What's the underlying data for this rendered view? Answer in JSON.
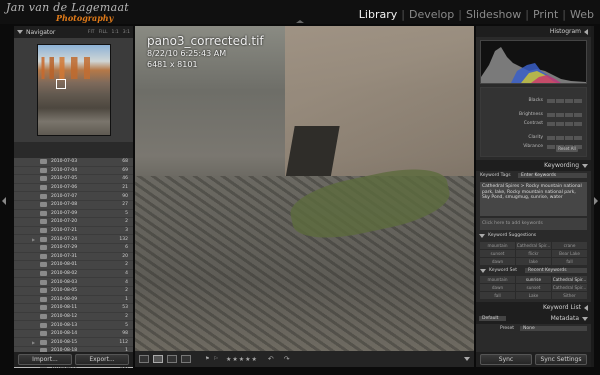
{
  "identity": {
    "name": "Jan van de Lagemaat",
    "subtitle": "Photography"
  },
  "modules": [
    {
      "label": "Library",
      "active": true
    },
    {
      "label": "Develop",
      "active": false
    },
    {
      "label": "Slideshow",
      "active": false
    },
    {
      "label": "Print",
      "active": false
    },
    {
      "label": "Web",
      "active": false
    }
  ],
  "navigator": {
    "title": "Navigator",
    "zooms": [
      "FIT",
      "FILL",
      "1:1",
      "3:1"
    ]
  },
  "folders": [
    {
      "name": "2010-07-03",
      "count": "68"
    },
    {
      "name": "2010-07-04",
      "count": "69"
    },
    {
      "name": "2010-07-05",
      "count": "46"
    },
    {
      "name": "2010-07-06",
      "count": "21"
    },
    {
      "name": "2010-07-07",
      "count": "90"
    },
    {
      "name": "2010-07-08",
      "count": "27"
    },
    {
      "name": "2010-07-09",
      "count": "5"
    },
    {
      "name": "2010-07-20",
      "count": "2"
    },
    {
      "name": "2010-07-21",
      "count": "3"
    },
    {
      "name": "2010-07-24",
      "count": "132"
    },
    {
      "name": "2010-07-29",
      "count": "6"
    },
    {
      "name": "2010-07-31",
      "count": "20"
    },
    {
      "name": "2010-08-01",
      "count": "2"
    },
    {
      "name": "2010-08-02",
      "count": "4"
    },
    {
      "name": "2010-08-03",
      "count": "4"
    },
    {
      "name": "2010-08-05",
      "count": "2"
    },
    {
      "name": "2010-08-09",
      "count": "1"
    },
    {
      "name": "2010-08-11",
      "count": "53"
    },
    {
      "name": "2010-08-12",
      "count": "2"
    },
    {
      "name": "2010-08-13",
      "count": "5"
    },
    {
      "name": "2010-08-14",
      "count": "98"
    },
    {
      "name": "2010-08-15",
      "count": "112"
    },
    {
      "name": "2010-08-18",
      "count": "1"
    },
    {
      "name": "2010-08-19",
      "count": "5"
    },
    {
      "name": "2010-08-22",
      "count": "200",
      "selected": true
    }
  ],
  "left_buttons": {
    "import": "Import...",
    "export": "Export..."
  },
  "photo": {
    "filename": "pano3_corrected.tif",
    "datetime": "8/22/10 6:25:43 AM",
    "dimensions": "6481 x 8101"
  },
  "toolbar": {
    "stars": "★★★★★"
  },
  "right": {
    "histogram_title": "Histogram",
    "quick_develop": [
      "Blacks",
      "Brightness",
      "Contrast",
      "Clarity",
      "Vibrance"
    ],
    "reset_all": "Reset All",
    "keywording_title": "Keywording",
    "keyword_tags_label": "Keyword Tags",
    "keyword_tags_value": "Enter Keywords",
    "keywords_text": "Cathedral Spires > Rocky mountain national park, lake, Rocky mountain national park, Sky Pond, smugmug, sunrise, water",
    "click_here": "Click here to add keywords",
    "suggestions_title": "Keyword Suggestions",
    "suggestions": [
      "mountain",
      "Cathedral Spir...",
      "crane",
      "sunset",
      "flickr",
      "Bear Lake",
      "dawn",
      "lake",
      "fall"
    ],
    "keyword_set_label": "Keyword Set",
    "keyword_set_value": "Recent Keywords",
    "recent": [
      "mountain",
      "sunrise",
      "Cathedral Spir...",
      "dawn",
      "sunset",
      "Cathedral Spir...",
      "fall",
      "Lake",
      "Sither"
    ],
    "keyword_list_title": "Keyword List",
    "metadata_title": "Metadata",
    "metadata_view": "Default",
    "preset_label": "Preset",
    "preset_value": "None",
    "sync_label": "Sync",
    "sync_settings_label": "Sync Settings"
  }
}
